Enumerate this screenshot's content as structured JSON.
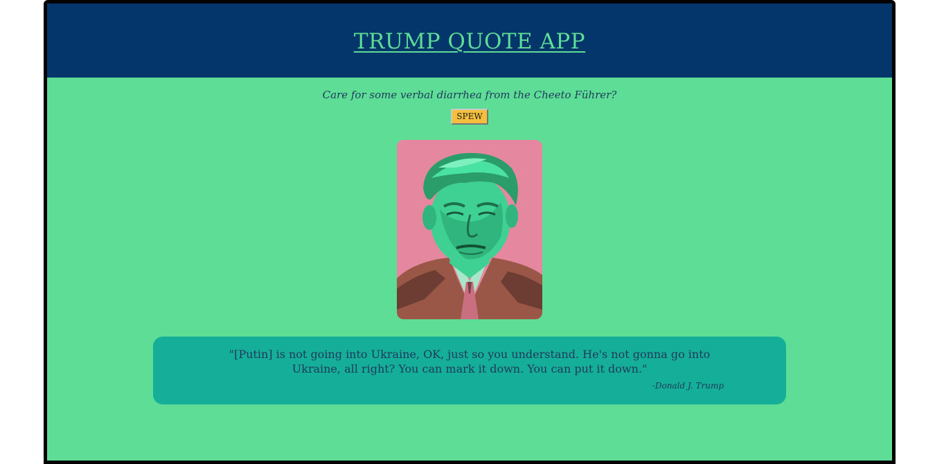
{
  "header": {
    "title": "TRUMP QUOTE APP"
  },
  "main": {
    "tagline": "Care for some verbal diarrhea from the Cheeto Führer?",
    "spew_label": "SPEW",
    "portrait_alt": "Donald Trump pop-art portrait"
  },
  "quote": {
    "text": "\"[Putin] is not going into Ukraine, OK, just so you understand. He's not gonna go into Ukraine, all right? You can mark it down. You can put it down.\"",
    "author": "-Donald J. Trump"
  },
  "colors": {
    "header_bg": "#04366b",
    "page_bg": "#5ddd95",
    "title": "#5ddd95",
    "button": "#f5be3c",
    "quote_bg": "#15ae98",
    "portrait_bg": "#e5879f",
    "text": "#1f3a5c"
  }
}
